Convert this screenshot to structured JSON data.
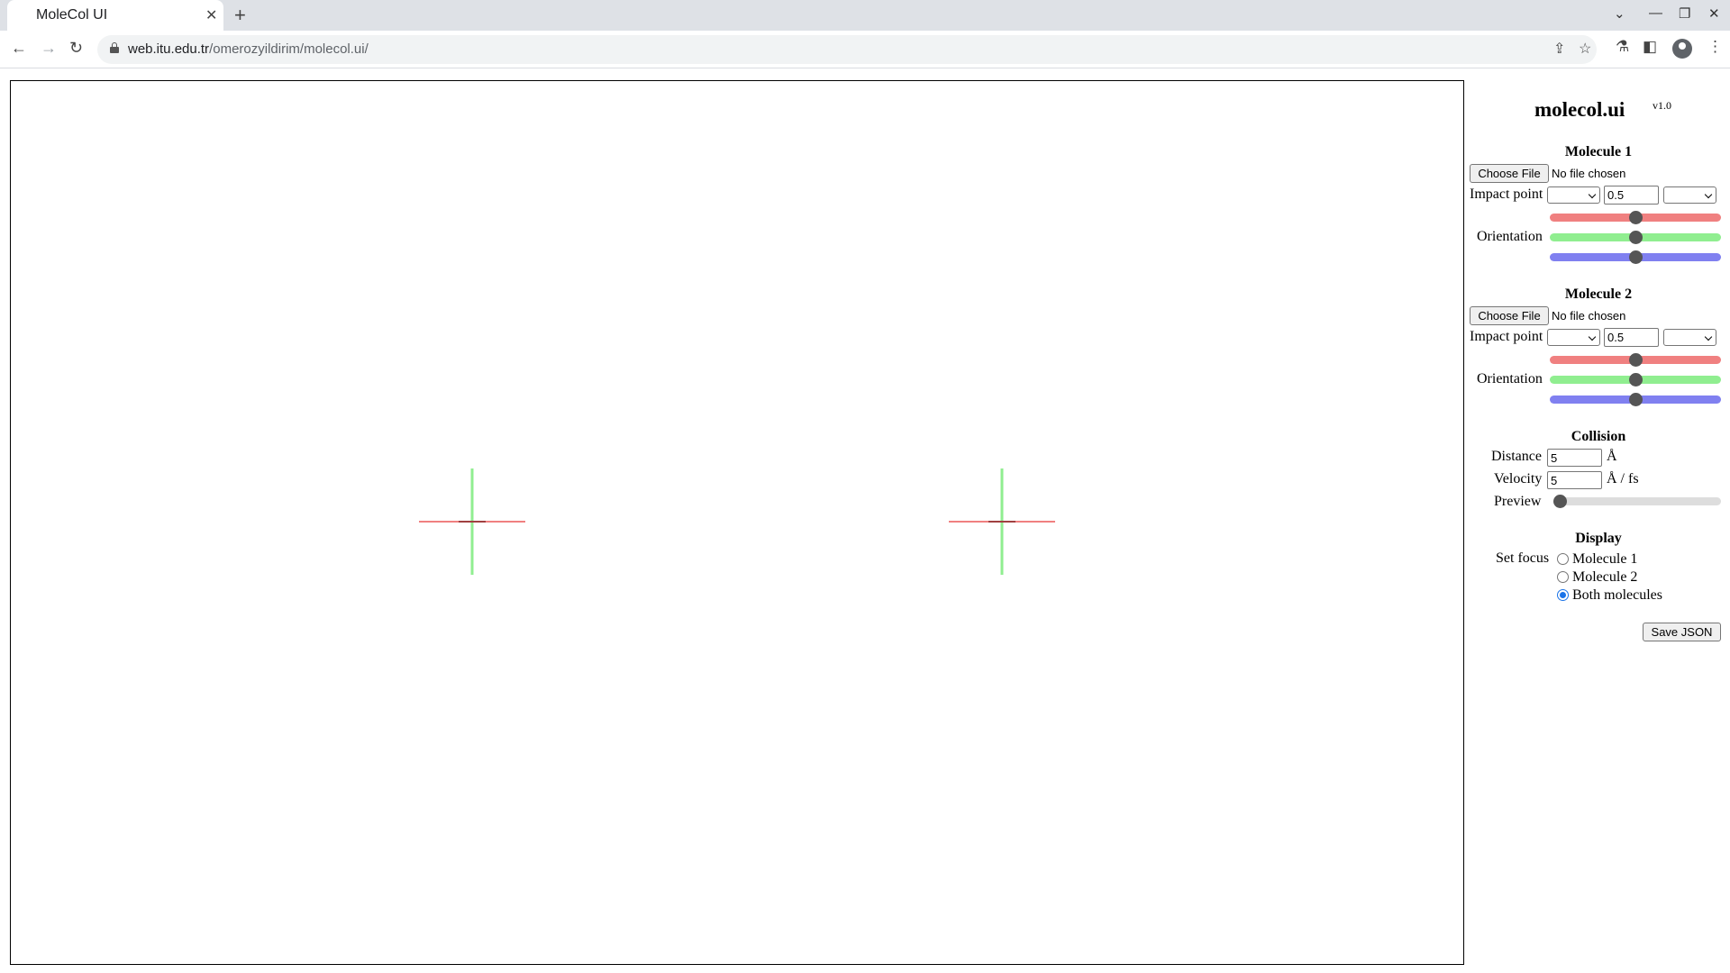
{
  "browser": {
    "tab_title": "MoleCol UI",
    "tab_close": "✕",
    "new_tab": "+",
    "url_host": "web.itu.edu.tr",
    "url_path": "/omerozyildirim/molecol.ui/",
    "icons": [
      "back-icon",
      "forward-icon",
      "reload-icon",
      "lock-icon",
      "share-icon",
      "star-icon",
      "labs-icon",
      "side-panel-icon",
      "profile-icon",
      "menu-icon"
    ]
  },
  "panel": {
    "title": "molecol.ui",
    "version": "v1.0",
    "molecule1": {
      "heading": "Molecule 1",
      "file_button": "Choose File",
      "file_status": "No file chosen",
      "impact_label": "Impact point",
      "impact_value": "0.5",
      "orientation_label": "Orientation",
      "orientation_levels": [
        0.5,
        0.5,
        0.5
      ]
    },
    "molecule2": {
      "heading": "Molecule 2",
      "file_button": "Choose File",
      "file_status": "No file chosen",
      "impact_label": "Impact point",
      "impact_value": "0.5",
      "orientation_label": "Orientation",
      "orientation_levels": [
        0.5,
        0.5,
        0.5
      ]
    },
    "collision": {
      "heading": "Collision",
      "distance_label": "Distance",
      "distance_value": "5",
      "distance_unit": "Å",
      "velocity_label": "Velocity",
      "velocity_value": "5",
      "velocity_unit": "Å / fs",
      "preview_label": "Preview",
      "preview_level": 0
    },
    "display": {
      "heading": "Display",
      "focus_label": "Set focus",
      "options": [
        "Molecule 1",
        "Molecule 2",
        "Both molecules"
      ],
      "selected": "Both molecules"
    },
    "save_button": "Save JSON"
  },
  "colors": {
    "x_axis": "#f08080",
    "y_axis": "#90ee90",
    "z_axis": "#8080f0",
    "radio_accent": "#1a73e8"
  }
}
